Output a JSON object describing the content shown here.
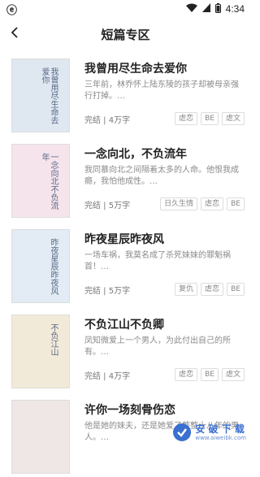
{
  "status": {
    "time": "4:34",
    "left_icon": "app-icon",
    "icons": [
      "wifi-icon",
      "signal-icon",
      "battery-icon"
    ]
  },
  "nav": {
    "title": "短篇专区",
    "back_icon": "chevron-left-icon"
  },
  "books": [
    {
      "title": "我曾用尽生命去爱你",
      "desc": "三年前，林乔怀上陆东陵的孩子却被母亲强行打掉。…",
      "meta": "完结 | 4万字",
      "tags": [
        "虐恋",
        "BE",
        "虐文"
      ],
      "cover_text": "我曾用尽生命去爱你",
      "cover_color": "#dfe8f0"
    },
    {
      "title": "一念向北，不负流年",
      "desc": "我同慕向北之间隔着太多的人命。他恨我成瘾，我怕他成性。…",
      "meta": "完结 | 5万字",
      "tags": [
        "日久生情",
        "虐恋",
        "BE"
      ],
      "cover_text": "一念向北不负流年",
      "cover_color": "#f6e4ec"
    },
    {
      "title": "昨夜星辰昨夜风",
      "desc": "一场车祸，我莫名成了杀死妹妹的罪魁祸首！…",
      "meta": "完结 | 5万字",
      "tags": [
        "复仇",
        "虐恋",
        "BE"
      ],
      "cover_text": "昨夜星辰昨夜风",
      "cover_color": "#e3ecf4"
    },
    {
      "title": "不负江山不负卿",
      "desc": "凤知微爱上一个男人，为此付出自己的所有。…",
      "meta": "完结 | 4万字",
      "tags": [
        "虐恋",
        "BE",
        "虐文"
      ],
      "cover_text": "不负江山",
      "cover_color": "#f2ead8"
    },
    {
      "title": "许你一场刻骨伤恋",
      "desc": "他是她的妹夫，还是她爱了整整十八年的男人。…",
      "meta": "",
      "tags": [],
      "cover_text": "",
      "cover_color": "#efe6e6"
    }
  ],
  "watermark": {
    "text": "安 破 下 载",
    "sub": "www.aiweibk.com"
  }
}
